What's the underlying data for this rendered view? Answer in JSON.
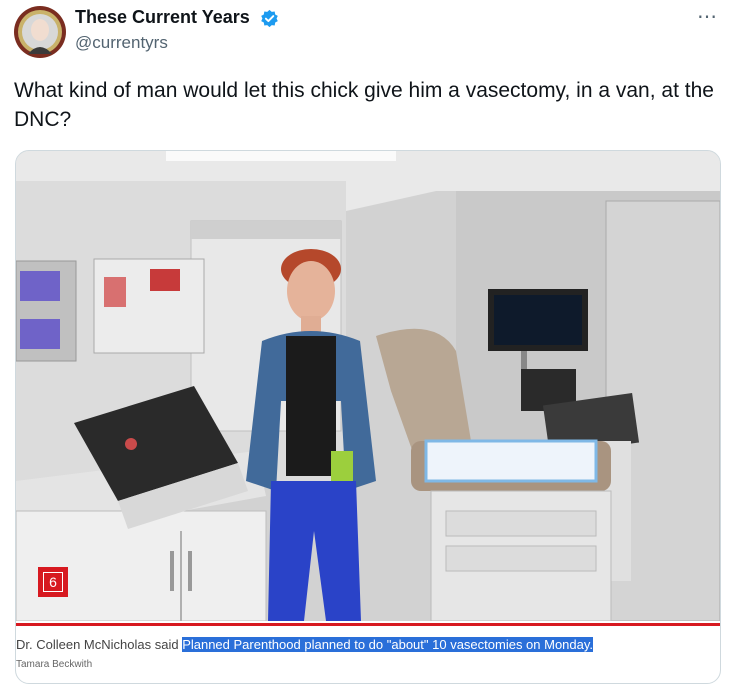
{
  "author": {
    "name": "These Current Years",
    "handle": "@currentyrs",
    "verified": true
  },
  "more_icon": "⋯",
  "tweet": {
    "text": "What kind of man would let this chick give him a vasectomy, in a van, at the DNC?"
  },
  "media": {
    "badge_number": "6",
    "caption_plain": "Dr. Colleen McNicholas said ",
    "caption_highlight": "Planned Parenthood planned to do \"about\" 10 vasectomies on Monday.",
    "credit": "Tamara Beckwith"
  },
  "colors": {
    "verified_blue": "#1d9bf0",
    "news_red": "#d71920",
    "highlight_blue": "#2a6fd9"
  }
}
